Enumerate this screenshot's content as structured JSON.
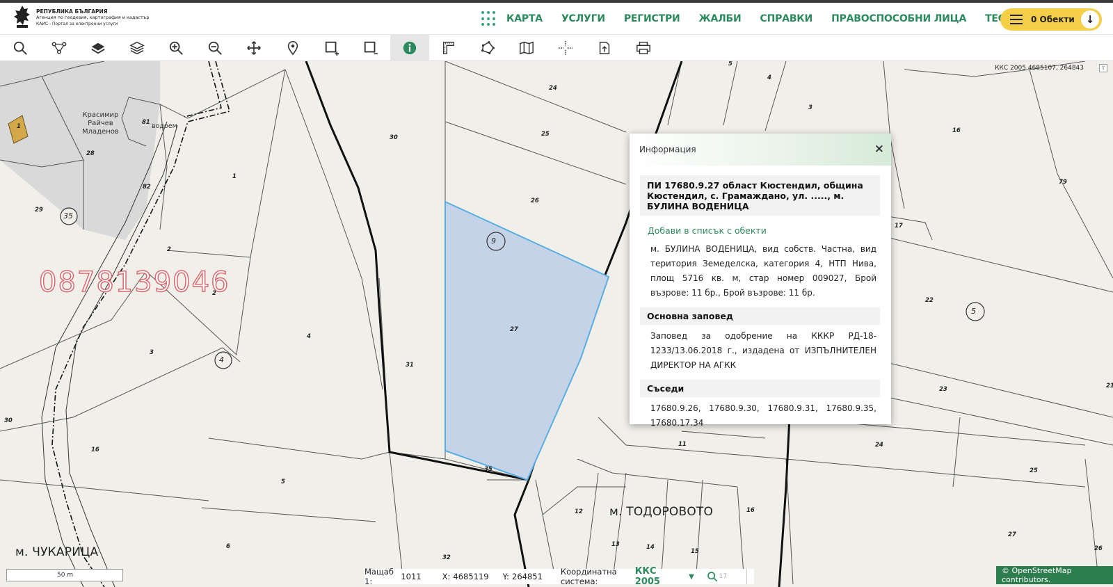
{
  "logo": {
    "line1": "РЕПУБЛИКА БЪЛГАРИЯ",
    "line2": "Агенция по геодезия, картография и кадастър",
    "line3": "КАИС - Портал за електронни услуги"
  },
  "nav": {
    "items": [
      "КАРТА",
      "УСЛУГИ",
      "РЕГИСТРИ",
      "ЖАЛБИ",
      "СПРАВКИ",
      "ПРАВОСПОСОБНИ ЛИЦА",
      "ТЕСТ"
    ],
    "objects_label": "0 Обекти"
  },
  "toolbar": {
    "tools": [
      "search-icon",
      "route-icon",
      "layer-icon",
      "layers-stack-icon",
      "zoom-in-icon",
      "zoom-out-icon",
      "pan-icon",
      "location-pin-icon",
      "rect-add-icon",
      "rect-remove-icon",
      "info-icon",
      "measure-icon",
      "polygon-icon",
      "map-book-icon",
      "crosshair-icon",
      "export-icon",
      "print-icon"
    ],
    "active_tool": "info-icon",
    "accent": "#2c8a5e"
  },
  "map": {
    "coords_top": "ККС 2005 4685107, 264843",
    "phone_overlay": "0878139046",
    "owner_label": [
      "Красимир",
      "Райчев",
      "Младенов"
    ],
    "vodoem": "водоем",
    "districts": [
      "м. ЧУКАРИЦА",
      "м. ТОДОРОВОТО"
    ],
    "parcel_labels": [
      "1",
      "28",
      "81",
      "82",
      "29",
      "1",
      "2",
      "2",
      "3",
      "4",
      "30",
      "25",
      "24",
      "26",
      "27",
      "31",
      "35",
      "16",
      "30",
      "5",
      "6",
      "32",
      "5",
      "4",
      "3",
      "16",
      "79",
      "17",
      "22",
      "23",
      "21",
      "24",
      "25",
      "27",
      "26",
      "11",
      "12",
      "13",
      "14",
      "15",
      "16"
    ],
    "circled_labels": [
      "35",
      "4",
      "9",
      "5"
    ],
    "highlight_color": "#c5d3e8",
    "highlight_stroke": "#5aaee0"
  },
  "popup": {
    "title": "Информация",
    "close": "×",
    "pi_title": "ПИ 17680.9.27 област Кюстендил, община Кюстендил, с. Грамаждано, ул. ....., м. БУЛИНА ВОДЕНИЦА",
    "add_link": "Добави в списък с обекти",
    "description": "м. БУЛИНА ВОДЕНИЦА, вид собств. Частна, вид територия Земеделска, категория 4, НТП Нива, площ 5716 кв. м, стар номер 009027, Брой възрове: 11 бр., Брой възрове: 11 бр.",
    "order_head": "Основна заповед",
    "order_text": "Заповед за одобрение на КККР РД-18-1233/13.06.2018 г., издадена от ИЗПЪЛНИТЕЛЕН ДИРЕКТОР НА АГКК",
    "neighbors_head": "Съседи",
    "neighbors_text": "17680.9.26,    17680.9.30,    17680.9.31,    17680.9.35, 17680.17.34"
  },
  "status": {
    "scale_label": "Мащаб 1:",
    "scale_value": "1011",
    "x_label": "X:",
    "x_value": "4685119",
    "y_label": "Y:",
    "y_value": "264851",
    "system_label": "Координатна система:",
    "system_value": "ККС 2005",
    "search_num": "17"
  },
  "scalebar": {
    "label": "50 m"
  },
  "attribution": "© OpenStreetMap contributors."
}
